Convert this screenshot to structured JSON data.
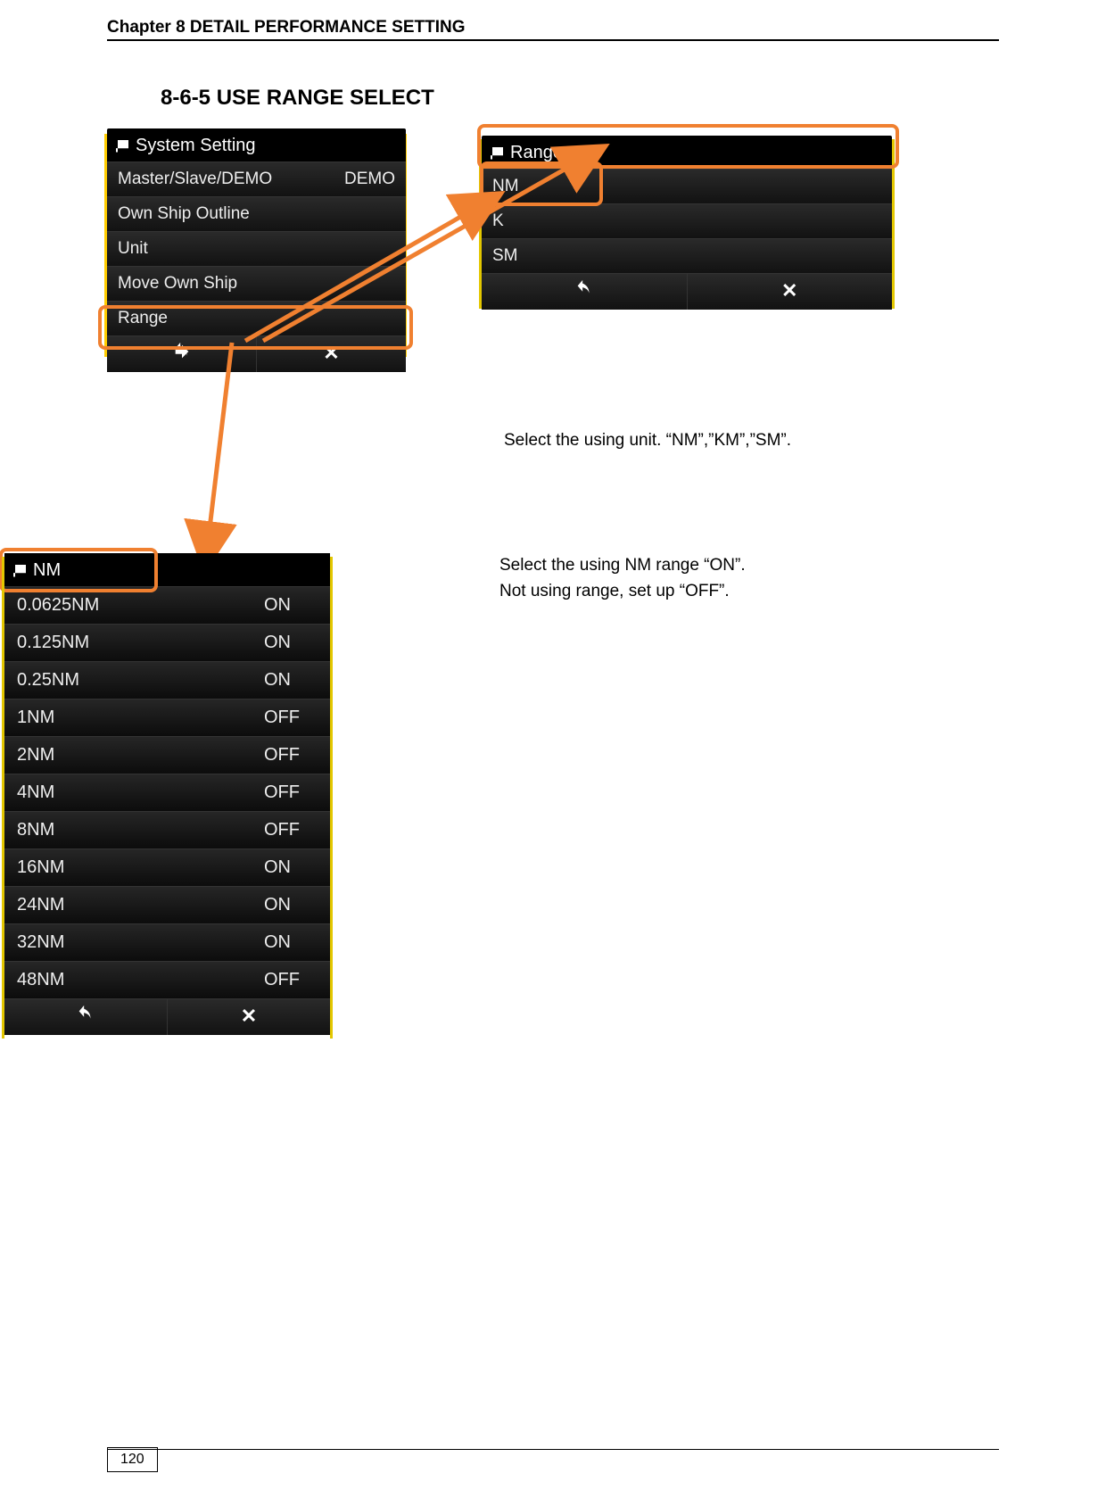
{
  "header": {
    "chapter": "Chapter 8    DETAIL PERFORMANCE SETTING"
  },
  "section": {
    "title": "8-6-5 USE RANGE SELECT"
  },
  "system_panel": {
    "title": "System Setting",
    "rows": [
      {
        "label": "Master/Slave/DEMO",
        "value": "DEMO"
      },
      {
        "label": "Own Ship Outline",
        "value": ""
      },
      {
        "label": "Unit",
        "value": ""
      },
      {
        "label": "Move Own Ship",
        "value": ""
      },
      {
        "label": "Range",
        "value": ""
      }
    ]
  },
  "range_panel": {
    "title": "Range",
    "rows": [
      {
        "label": "NM"
      },
      {
        "label": "K"
      },
      {
        "label": "SM"
      }
    ]
  },
  "nm_panel": {
    "title": "NM",
    "rows": [
      {
        "label": "0.0625NM",
        "value": "ON"
      },
      {
        "label": "0.125NM",
        "value": "ON"
      },
      {
        "label": "0.25NM",
        "value": "ON"
      },
      {
        "label": "1NM",
        "value": "OFF"
      },
      {
        "label": "2NM",
        "value": "OFF"
      },
      {
        "label": "4NM",
        "value": "OFF"
      },
      {
        "label": "8NM",
        "value": "OFF"
      },
      {
        "label": "16NM",
        "value": "ON"
      },
      {
        "label": "24NM",
        "value": "ON"
      },
      {
        "label": "32NM",
        "value": "ON"
      },
      {
        "label": "48NM",
        "value": "OFF"
      }
    ]
  },
  "instructions": {
    "select_unit": "Select the using unit. “NM”,”KM”,”SM”.",
    "select_range_on": "Select the using NM range “ON”.",
    "select_range_off": "Not using range, set up “OFF”."
  },
  "page_number": "120"
}
